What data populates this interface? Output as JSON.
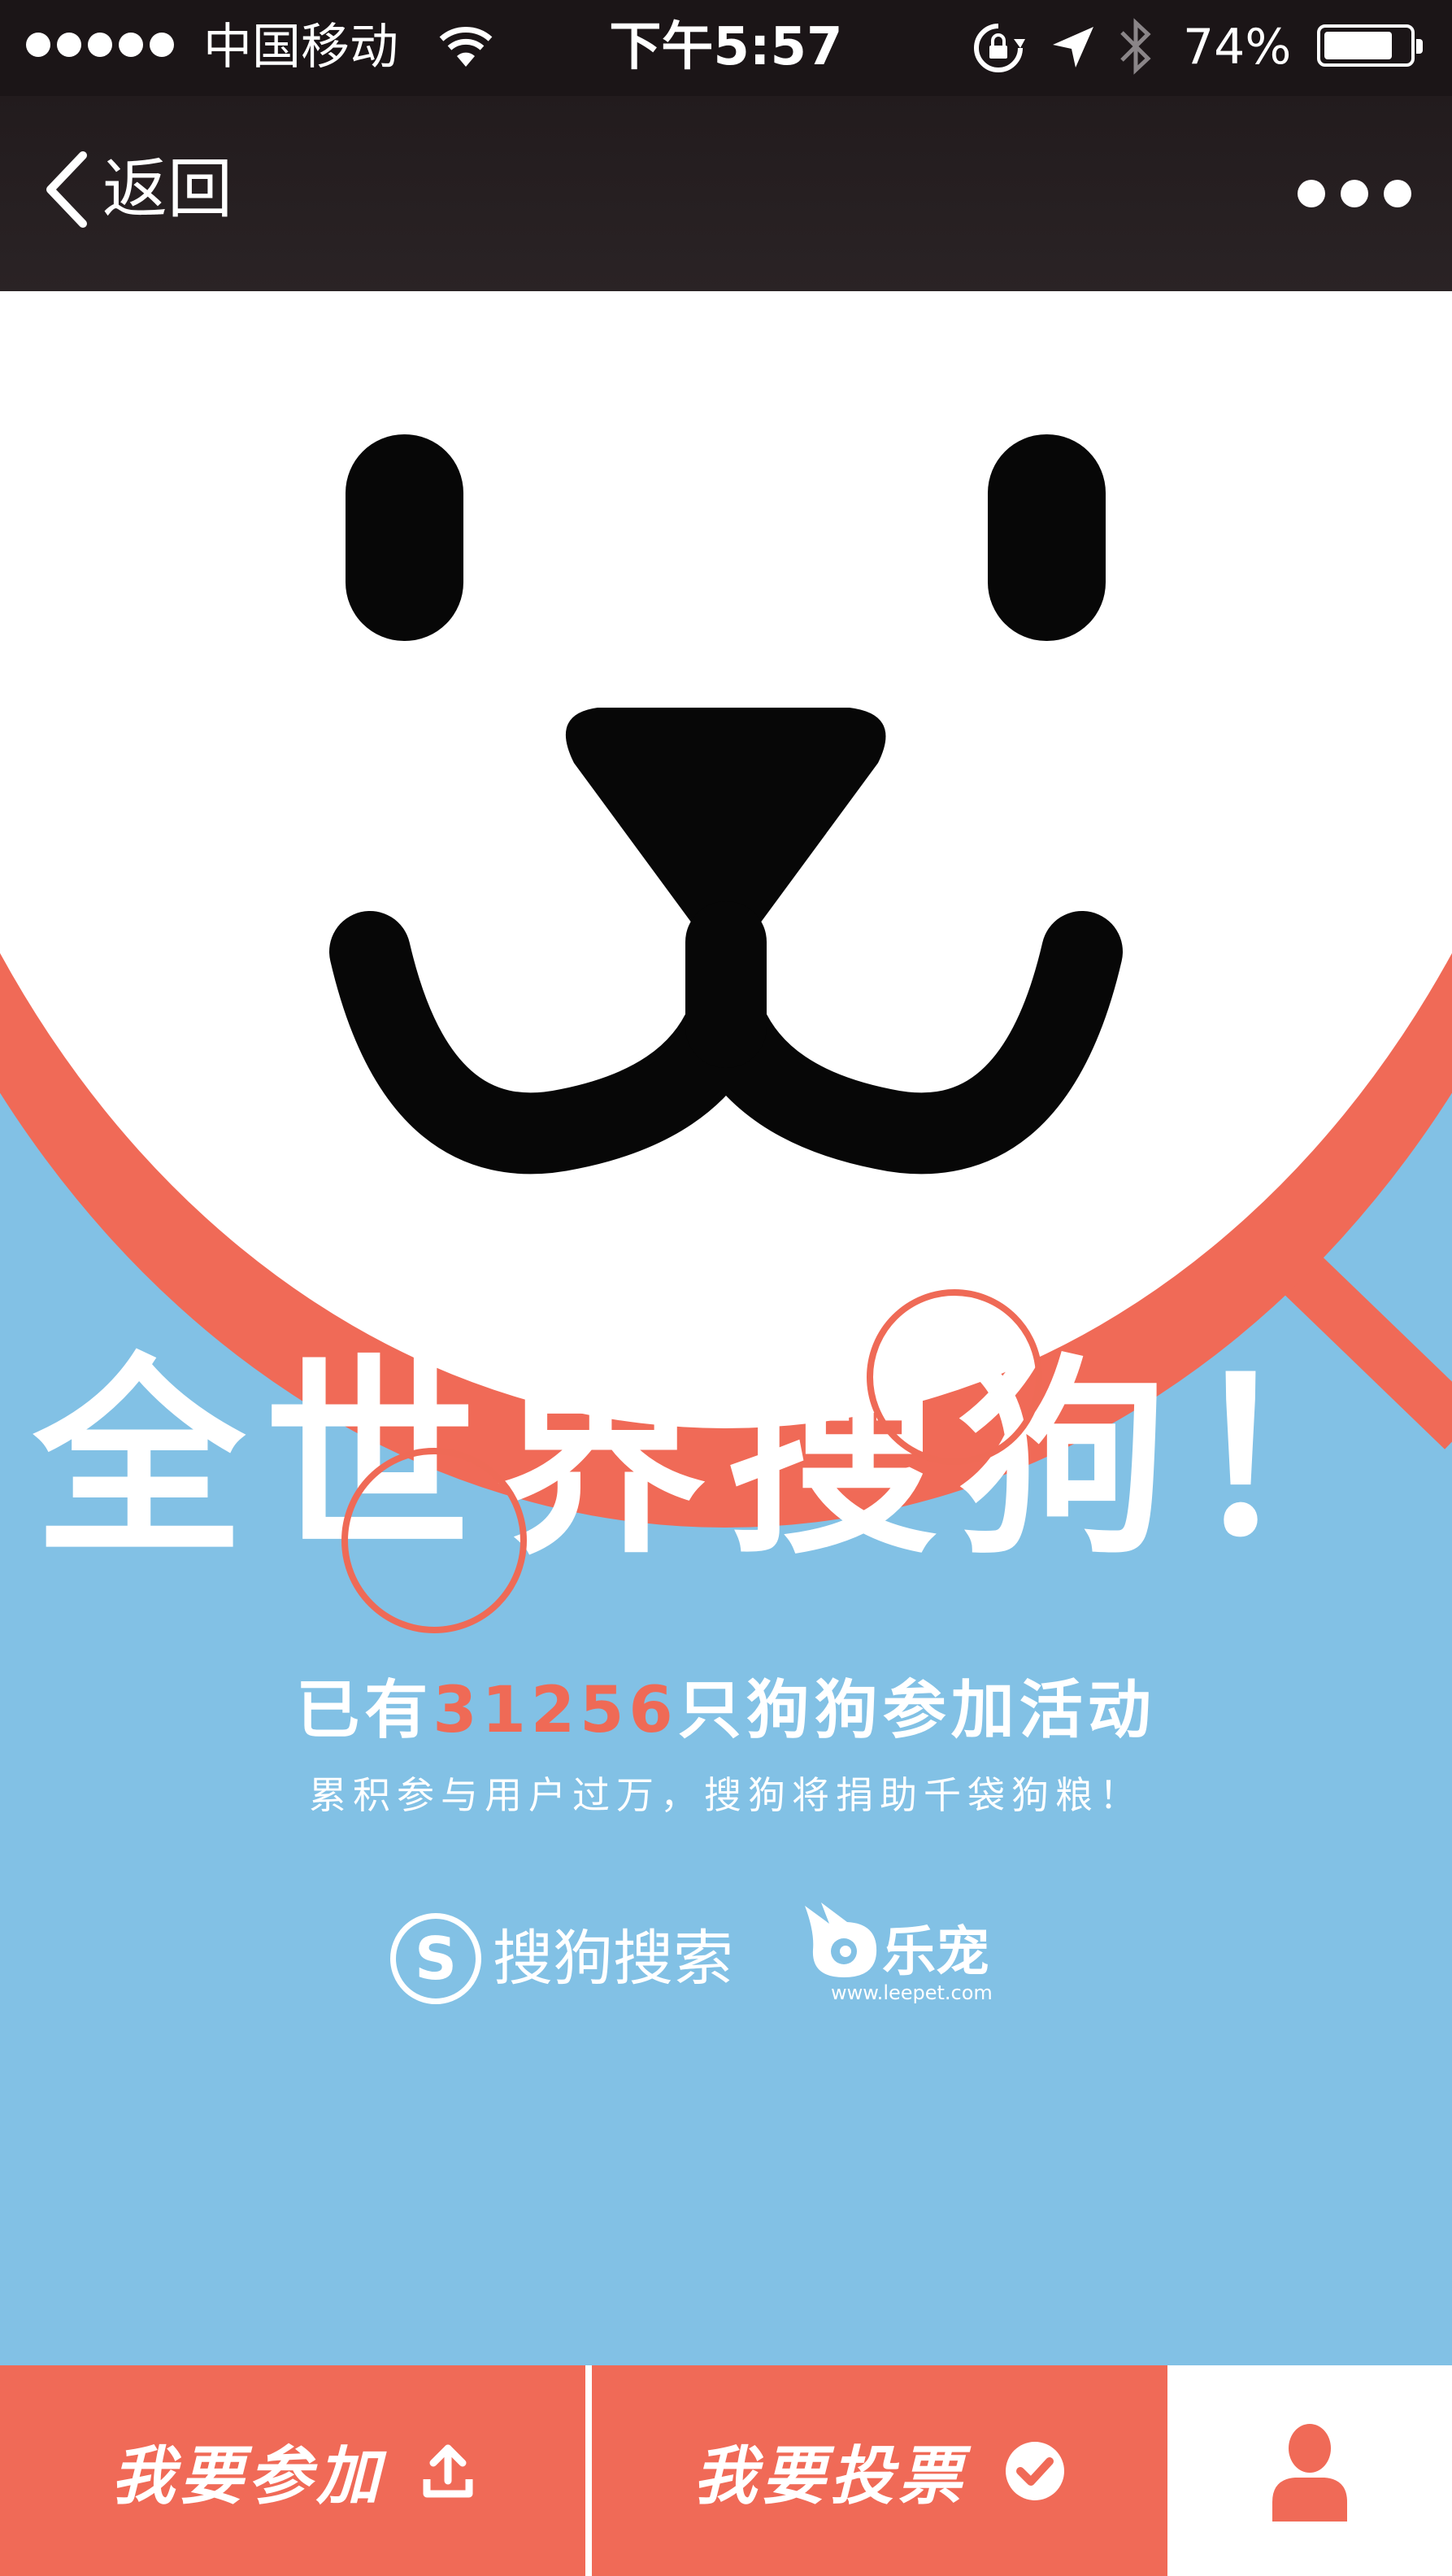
{
  "status_bar": {
    "carrier": "中国移动",
    "time": "下午5:57",
    "battery": "74%",
    "battery_level": 0.74
  },
  "nav": {
    "back_label": "返回"
  },
  "hero": {
    "headline": "全世界搜狗！",
    "stats_prefix": "已有",
    "stats_count": "31256",
    "stats_suffix": "只狗狗参加活动",
    "subline": "累积参与用户过万，搜狗将捐助千袋狗粮！",
    "sogou_logo_text": "搜狗搜索",
    "leepet_logo_text": "乐宠",
    "leepet_url": "www.leepet.com"
  },
  "tabbar": {
    "join_label": "我要参加",
    "vote_label": "我要投票"
  },
  "colors": {
    "coral": "#f06a57",
    "sky": "#82c1e5",
    "dark": "#1b1517"
  },
  "icons": [
    "wifi-icon",
    "lock-rotation-icon",
    "location-icon",
    "bluetooth-icon",
    "back-chevron-icon",
    "more-dots-icon",
    "upload-icon",
    "check-circle-icon",
    "user-icon"
  ]
}
